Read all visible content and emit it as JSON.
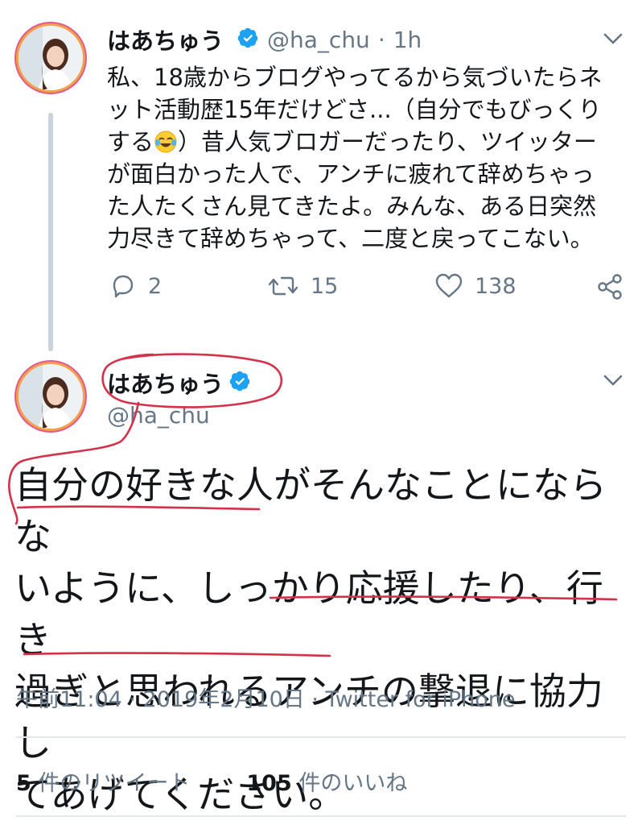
{
  "tweet1": {
    "name": "はあちゅう",
    "handle": "@ha_chu",
    "separator": "·",
    "time": "1h",
    "text_lines": [
      "私、18歳からブログやってるから気づいたらネ",
      "ット活動歴15年だけどさ...（自分でもびっくり",
      "する",
      "）昔人気ブロガーだったり、ツイッター",
      "が面白かった人で、アンチに疲れて辞めちゃっ",
      "た人たくさん見てきたよ。みんな、ある日突然",
      "力尽きて辞めちゃって、二度と戻ってこない。"
    ],
    "emoji_icon": "face-with-tears-of-joy-emoji",
    "replies": "2",
    "retweets": "15",
    "likes": "138"
  },
  "tweet2": {
    "name": "はあちゅう",
    "handle": "@ha_chu",
    "text_lines": [
      "自分の好きな人がそんなことにならな",
      "いように、しっかり応援したり、行き",
      "過ぎと思われるアンチの撃退に協力し",
      "てあげてください。"
    ],
    "timestamp": "午前11:04 · 2019年2月10日 · Twitter for iPhone",
    "retweet_count": "5",
    "retweet_label": "件のリツイート",
    "like_count": "105",
    "like_label": "件のいいね"
  },
  "colors": {
    "text": "#14171a",
    "secondary": "#657786",
    "verified": "#1da1f2",
    "annotation_ink": "#d4324b",
    "thread_line": "#c9d3db"
  }
}
